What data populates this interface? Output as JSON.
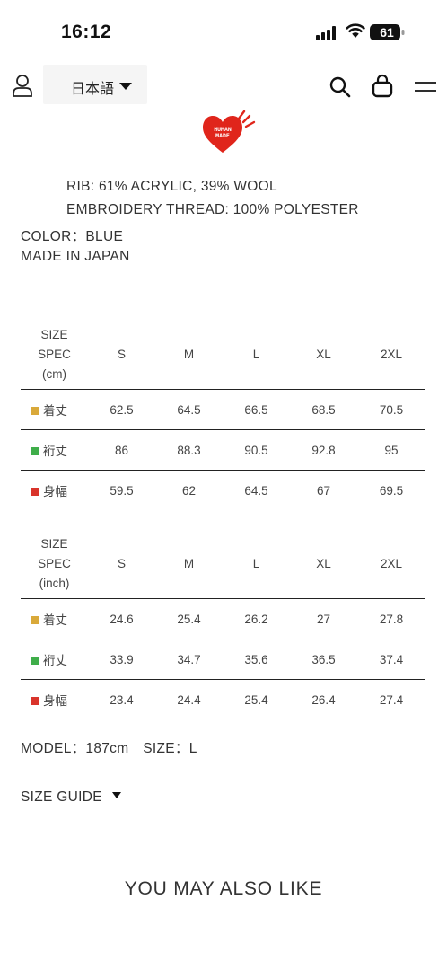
{
  "status_bar": {
    "time": "16:12",
    "battery": "61"
  },
  "header": {
    "language_label": "日本語",
    "logo_text_1": "HUMAN",
    "logo_text_2": "MADE"
  },
  "colors": {
    "length_marker": "#d9a93a",
    "sleeve_marker": "#3fae4a",
    "width_marker": "#d9342b",
    "logo_red": "#e0251b"
  },
  "details": {
    "rib": "RIB: 61% ACRYLIC, 39% WOOL",
    "embroidery": "EMBROIDERY THREAD: 100% POLYESTER",
    "color": "COLOR：BLUE",
    "made_in": "MADE IN JAPAN"
  },
  "size_chart_cm": {
    "header": {
      "l1": "SIZE",
      "l2": "SPEC",
      "l3": "(cm)"
    },
    "sizes": [
      "S",
      "M",
      "L",
      "XL",
      "2XL"
    ],
    "rows": [
      {
        "label": "着丈",
        "values": [
          "62.5",
          "64.5",
          "66.5",
          "68.5",
          "70.5"
        ]
      },
      {
        "label": "裄丈",
        "values": [
          "86",
          "88.3",
          "90.5",
          "92.8",
          "95"
        ]
      },
      {
        "label": "身幅",
        "values": [
          "59.5",
          "62",
          "64.5",
          "67",
          "69.5"
        ]
      }
    ]
  },
  "size_chart_inch": {
    "header": {
      "l1": "SIZE",
      "l2": "SPEC",
      "l3": "(inch)"
    },
    "sizes": [
      "S",
      "M",
      "L",
      "XL",
      "2XL"
    ],
    "rows": [
      {
        "label": "着丈",
        "values": [
          "24.6",
          "25.4",
          "26.2",
          "27",
          "27.8"
        ]
      },
      {
        "label": "裄丈",
        "values": [
          "33.9",
          "34.7",
          "35.6",
          "36.5",
          "37.4"
        ]
      },
      {
        "label": "身幅",
        "values": [
          "23.4",
          "24.4",
          "25.4",
          "26.4",
          "27.4"
        ]
      }
    ]
  },
  "model_info": "MODEL：187cm　SIZE：L",
  "size_guide_label": "SIZE GUIDE",
  "recommend_title": "YOU MAY ALSO LIKE"
}
